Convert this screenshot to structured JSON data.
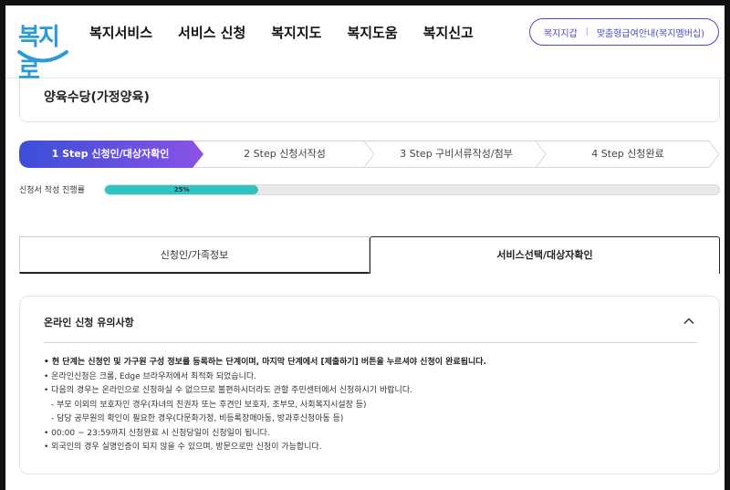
{
  "header": {
    "logo_text": "복지로",
    "nav": [
      "복지서비스",
      "서비스 신청",
      "복지지도",
      "복지도움",
      "복지신고"
    ],
    "util_links": [
      "복지지갑",
      "맞춤형급여안내(복지멤버십)"
    ]
  },
  "page": {
    "title": "양육수당(가정양육)"
  },
  "steps": [
    {
      "label": "1 Step 신청인/대상자확인",
      "active": true
    },
    {
      "label": "2 Step 신청서작성",
      "active": false
    },
    {
      "label": "3 Step 구비서류작성/첨부",
      "active": false
    },
    {
      "label": "4 Step 신청완료",
      "active": false
    }
  ],
  "progress": {
    "label": "신청서 작성 진행률",
    "percent": 25,
    "text": "25%"
  },
  "tabs": [
    {
      "label": "신청인/가족정보",
      "active": false
    },
    {
      "label": "서비스선택/대상자확인",
      "active": true
    }
  ],
  "notice": {
    "title": "온라인 신청 유의사항",
    "lines": [
      {
        "text": "• 현 단계는 신청인 및 가구원 구성 정보를 등록하는 단계이며, 마지막 단계에서 [제출하기] 버튼을 누르셔야 신청이 완료됩니다.",
        "style": "strong"
      },
      {
        "text": "• 온라인신청은 크롬, Edge 브라우저에서 최적화 되었습니다.",
        "style": "normal"
      },
      {
        "text": "• 다음의 경우는 온라인으로 신청하실 수 없으므로 불편하시더라도 관할 주민센터에서 신청하시기 바랍니다.",
        "style": "normal"
      },
      {
        "text": "- 부모 이외의 보호자인 경우(자녀의 친권자 또는 후견인 보호자, 조부모, 사회복지시설장 등)",
        "style": "sub"
      },
      {
        "text": "- 담당 공무원의 확인이 필요한 경우(다문화가정, 비등록장애아동, 방과후신청아동 등)",
        "style": "sub"
      },
      {
        "text": "• 00:00 ~ 23:59까지 신청완료 시 신청당일이 신청일이 됩니다.",
        "style": "normal"
      },
      {
        "text": "• 외국인의 경우 실명인증이 되지 않을 수 있으며, 방문으로만 신청이 가능합니다.",
        "style": "normal"
      }
    ]
  },
  "colors": {
    "accent": "#4a48c8",
    "step_active_start": "#3b4fd8",
    "step_active_end": "#8a52e6",
    "progress_fill": "#2ec4c4"
  }
}
